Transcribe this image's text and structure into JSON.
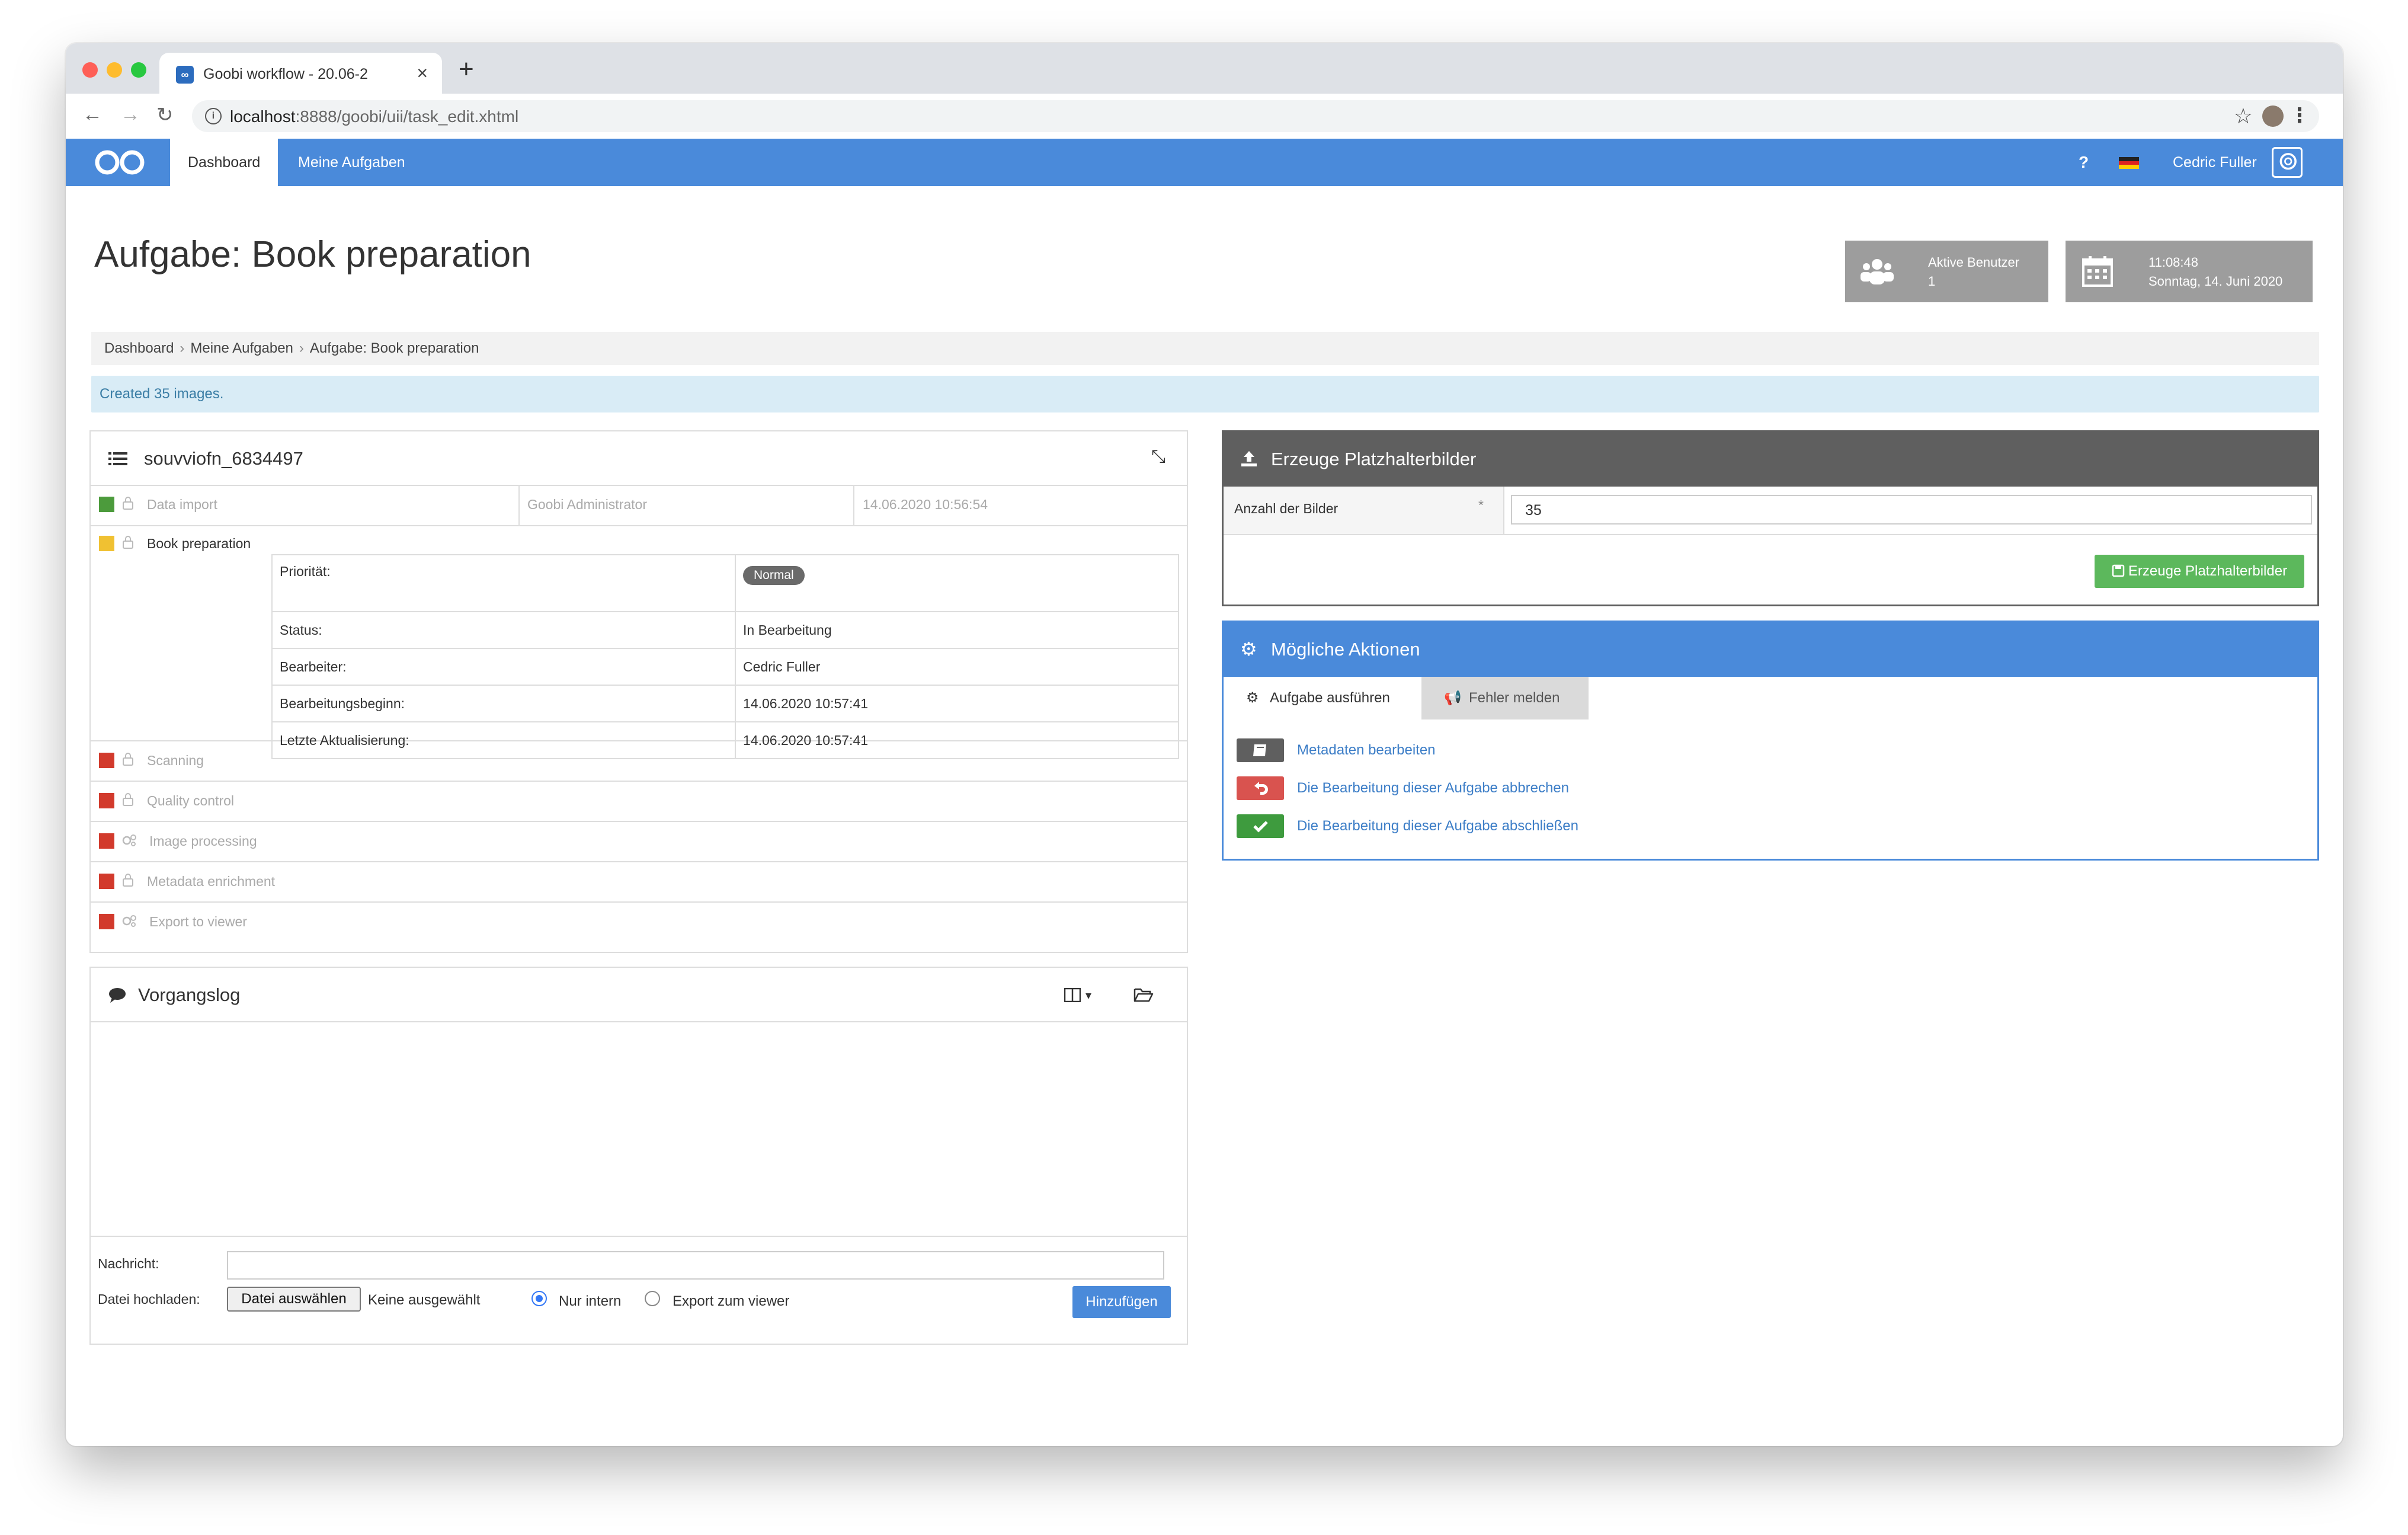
{
  "browser": {
    "tab_title": "Goobi workflow - 20.06-2",
    "url_host": "localhost",
    "url_rest": ":8888/goobi/uii/task_edit.xhtml"
  },
  "navbar": {
    "items": [
      {
        "label": "Dashboard",
        "active": true
      },
      {
        "label": "Meine Aufgaben",
        "active": false
      }
    ],
    "help": "?",
    "user": "Cedric Fuller",
    "color": "#4a8ada"
  },
  "page": {
    "title": "Aufgabe: Book preparation"
  },
  "widgets": {
    "active_users": {
      "label": "Aktive Benutzer",
      "value": "1"
    },
    "clock": {
      "time": "11:08:48",
      "date": "Sonntag, 14. Juni 2020"
    }
  },
  "breadcrumb": [
    "Dashboard",
    "Meine Aufgaben",
    "Aufgabe: Book preparation"
  ],
  "alert": {
    "text": "Created 35 images."
  },
  "process_box": {
    "title": "souvviofn_6834497",
    "steps": [
      {
        "name": "Data import",
        "status": "done",
        "color": "#4c9b3c",
        "icon": "lock-icon",
        "user": "Goobi Administrator",
        "date": "14.06.2020 10:56:54"
      },
      {
        "name": "Book preparation",
        "status": "in-progress",
        "color": "#f0c132",
        "icon": "lock-icon"
      },
      {
        "name": "Scanning",
        "status": "locked",
        "color": "#d23a2c",
        "icon": "lock-icon"
      },
      {
        "name": "Quality control",
        "status": "locked",
        "color": "#d23a2c",
        "icon": "lock-icon"
      },
      {
        "name": "Image processing",
        "status": "locked",
        "color": "#d23a2c",
        "icon": "cogs-icon"
      },
      {
        "name": "Metadata enrichment",
        "status": "locked",
        "color": "#d23a2c",
        "icon": "lock-icon"
      },
      {
        "name": "Export to viewer",
        "status": "locked",
        "color": "#d23a2c",
        "icon": "cogs-icon"
      }
    ],
    "details": [
      {
        "label": "Priorität:",
        "value": "Normal"
      },
      {
        "label": "Status:",
        "value": "In Bearbeitung"
      },
      {
        "label": "Bearbeiter:",
        "value": "Cedric Fuller"
      },
      {
        "label": "Bearbeitungsbeginn:",
        "value": "14.06.2020 10:57:41"
      },
      {
        "label": "Letzte Aktualisierung:",
        "value": "14.06.2020 10:57:41"
      }
    ]
  },
  "log_box": {
    "title": "Vorgangslog",
    "message_label": "Nachricht:",
    "message_value": "",
    "upload_label": "Datei hochladen:",
    "choose_file": "Datei auswählen",
    "no_file": "Keine ausgewählt",
    "radio_internal": "Nur intern",
    "radio_export": "Export zum viewer",
    "add_button": "Hinzufügen"
  },
  "placeholder_panel": {
    "title": "Erzeuge Platzhalterbilder",
    "field_label": "Anzahl der Bilder",
    "required": "*",
    "field_value": "35",
    "button": "Erzeuge Platzhalterbilder",
    "head_color": "#5f5f5f",
    "button_color": "#5cb85c"
  },
  "actions_panel": {
    "title": "Mögliche Aktionen",
    "tabs": [
      {
        "label": "Aufgabe ausführen",
        "active": true
      },
      {
        "label": "Fehler melden",
        "active": false
      }
    ],
    "actions": [
      {
        "label": "Metadaten bearbeiten",
        "icon": "book-icon",
        "color": "#5f5f5f"
      },
      {
        "label": "Die Bearbeitung dieser Aufgabe abbrechen",
        "icon": "undo-icon",
        "color": "#d9534f"
      },
      {
        "label": "Die Bearbeitung dieser Aufgabe abschließen",
        "icon": "check-icon",
        "color": "#3e9b3e"
      }
    ],
    "head_color": "#4a8ada"
  }
}
